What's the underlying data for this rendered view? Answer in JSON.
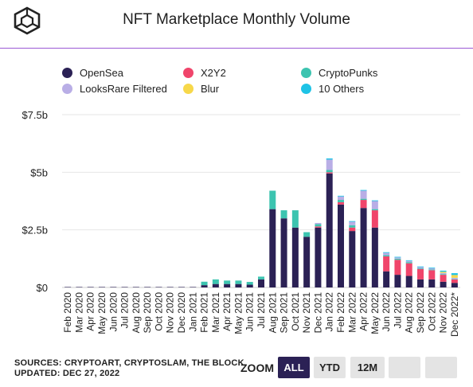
{
  "title": "NFT Marketplace Monthly Volume",
  "legend": [
    {
      "name": "OpenSea",
      "color": "#2b2155"
    },
    {
      "name": "X2Y2",
      "color": "#f0456b"
    },
    {
      "name": "CryptoPunks",
      "color": "#3cc4b0"
    },
    {
      "name": "LooksRare Filtered",
      "color": "#b9aee6"
    },
    {
      "name": "Blur",
      "color": "#f7d84a"
    },
    {
      "name": "10 Others",
      "color": "#1ec3e6"
    }
  ],
  "footer": {
    "sources": "SOURCES: CRYPTOART, CRYPTOSLAM, THE BLOCK",
    "updated": "UPDATED: DEC 27, 2022"
  },
  "zoom": {
    "label": "ZOOM",
    "buttons": [
      {
        "label": "ALL",
        "active": true
      },
      {
        "label": "YTD",
        "active": false
      },
      {
        "label": "12M",
        "active": false
      },
      {
        "label": "",
        "active": false
      },
      {
        "label": "",
        "active": false
      }
    ]
  },
  "chart_data": {
    "type": "bar",
    "stacked": true,
    "title": "NFT Marketplace Monthly Volume",
    "ylim": [
      0,
      7.5
    ],
    "yticks": [
      {
        "value": 0,
        "label": "$0"
      },
      {
        "value": 2.5,
        "label": "$2.5b"
      },
      {
        "value": 5,
        "label": "$5b"
      },
      {
        "value": 7.5,
        "label": "$7.5b"
      }
    ],
    "grid": true,
    "legend_position": "top",
    "categories": [
      "Feb 2020",
      "Mar 2020",
      "Apr 2020",
      "May 2020",
      "Jun 2020",
      "Jul 2020",
      "Aug 2020",
      "Sep 2020",
      "Oct 2020",
      "Nov 2020",
      "Dec 2020",
      "Jan 2021",
      "Feb 2021",
      "Mar 2021",
      "Apr 2021",
      "May 2021",
      "Jun 2021",
      "Jul 2021",
      "Aug 2021",
      "Sep 2021",
      "Oct 2021",
      "Nov 2021",
      "Dec 2021",
      "Jan 2022",
      "Feb 2022",
      "Mar 2022",
      "Apr 2022",
      "May 2022",
      "Jun 2022",
      "Jul 2022",
      "Aug 2022",
      "Sep 2022",
      "Oct 2022",
      "Nov 2022",
      "Dec 2022*"
    ],
    "series": [
      {
        "name": "OpenSea",
        "color": "#2b2155",
        "values": [
          0.005,
          0.005,
          0.005,
          0.005,
          0.005,
          0.005,
          0.005,
          0.005,
          0.005,
          0.005,
          0.01,
          0.01,
          0.1,
          0.15,
          0.15,
          0.15,
          0.12,
          0.35,
          3.4,
          3.0,
          2.6,
          2.2,
          2.6,
          4.95,
          3.6,
          2.45,
          3.45,
          2.6,
          0.7,
          0.55,
          0.5,
          0.35,
          0.35,
          0.25,
          0.2
        ]
      },
      {
        "name": "X2Y2",
        "color": "#f0456b",
        "values": [
          0,
          0,
          0,
          0,
          0,
          0,
          0,
          0,
          0,
          0,
          0,
          0,
          0,
          0,
          0,
          0,
          0,
          0,
          0,
          0,
          0,
          0,
          0.05,
          0.05,
          0.1,
          0.15,
          0.35,
          0.75,
          0.65,
          0.65,
          0.55,
          0.45,
          0.4,
          0.3,
          0.15
        ]
      },
      {
        "name": "CryptoPunks",
        "color": "#3cc4b0",
        "values": [
          0,
          0,
          0,
          0,
          0,
          0,
          0,
          0,
          0,
          0,
          0,
          0,
          0.15,
          0.2,
          0.15,
          0.15,
          0.12,
          0.12,
          0.8,
          0.35,
          0.75,
          0.2,
          0.1,
          0.1,
          0.1,
          0.1,
          0.05,
          0.05,
          0.05,
          0.05,
          0.05,
          0.03,
          0.03,
          0.03,
          0.02
        ]
      },
      {
        "name": "LooksRare Filtered",
        "color": "#b9aee6",
        "values": [
          0,
          0,
          0,
          0,
          0,
          0,
          0,
          0,
          0,
          0,
          0,
          0,
          0,
          0,
          0,
          0,
          0,
          0,
          0,
          0,
          0,
          0,
          0.05,
          0.45,
          0.15,
          0.15,
          0.35,
          0.35,
          0.1,
          0.05,
          0.05,
          0.05,
          0.05,
          0.05,
          0.05
        ]
      },
      {
        "name": "Blur",
        "color": "#f7d84a",
        "values": [
          0,
          0,
          0,
          0,
          0,
          0,
          0,
          0,
          0,
          0,
          0,
          0,
          0,
          0,
          0,
          0,
          0,
          0,
          0,
          0,
          0,
          0,
          0,
          0,
          0,
          0,
          0,
          0,
          0,
          0,
          0,
          0,
          0,
          0.05,
          0.12
        ]
      },
      {
        "name": "10 Others",
        "color": "#1ec3e6",
        "values": [
          0,
          0,
          0,
          0,
          0,
          0,
          0,
          0,
          0,
          0,
          0,
          0,
          0,
          0,
          0,
          0,
          0,
          0,
          0,
          0,
          0,
          0,
          0,
          0.05,
          0.03,
          0.03,
          0.03,
          0.03,
          0.03,
          0.03,
          0.03,
          0.03,
          0.03,
          0.05,
          0.08
        ]
      }
    ]
  }
}
